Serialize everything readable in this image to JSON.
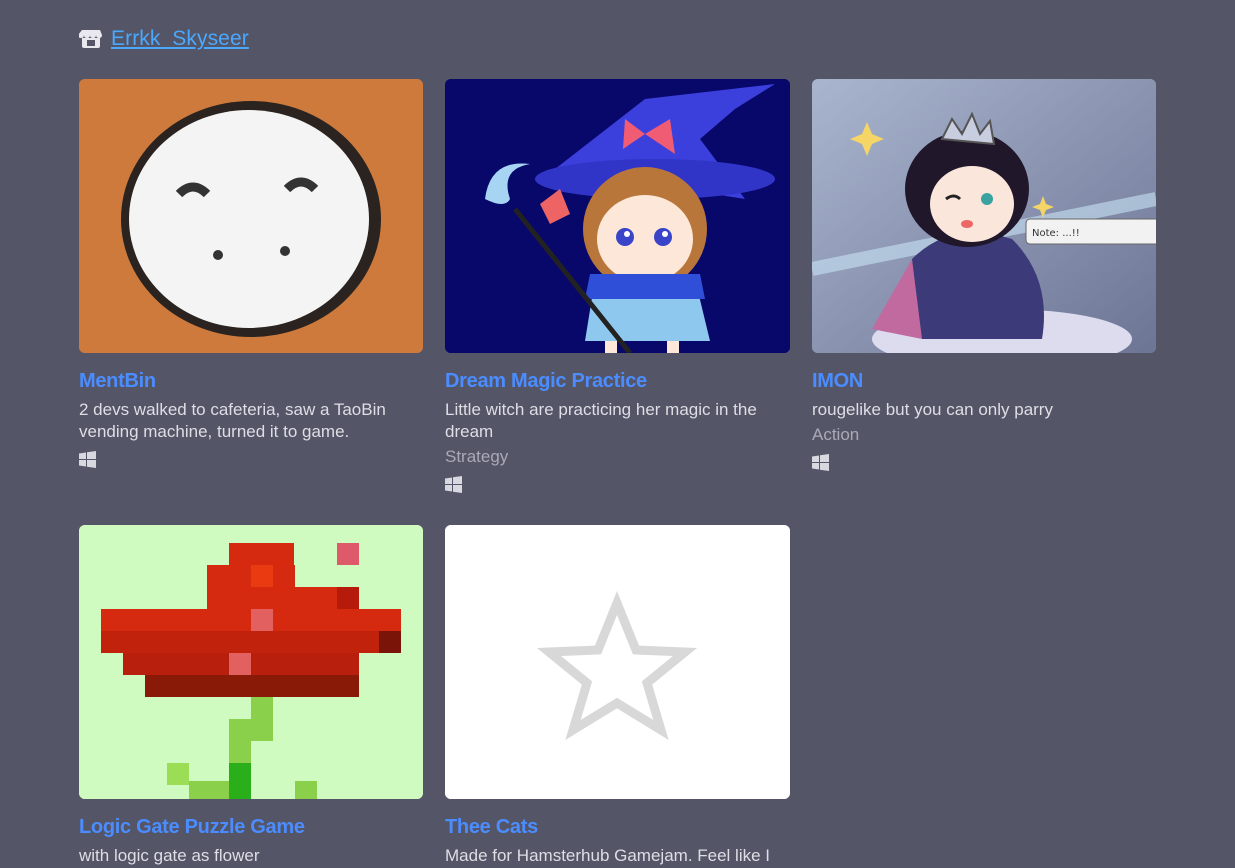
{
  "user": {
    "name": "Errkk_Skyseer"
  },
  "games": [
    {
      "title": "MentBin",
      "description": "2 devs walked to cafeteria, saw a TaoBin vending machine, turned it to game.",
      "genre": "",
      "platform": "windows-icon"
    },
    {
      "title": "Dream Magic Practice",
      "description": "Little witch are practicing her magic in the dream",
      "genre": "Strategy",
      "platform": "windows-icon"
    },
    {
      "title": "IMON",
      "description": "rougelike but you can only parry",
      "genre": "Action",
      "platform": "windows-icon"
    },
    {
      "title": "Logic Gate Puzzle Game",
      "description": "with logic gate as flower",
      "genre": "",
      "platform": ""
    },
    {
      "title": "Thee Cats",
      "description": "Made for Hamsterhub Gamejam. Feel like I",
      "genre": "",
      "platform": ""
    }
  ],
  "colors": {
    "background": "#545566",
    "link": "#4aa8ff",
    "title": "#4b8dff"
  }
}
